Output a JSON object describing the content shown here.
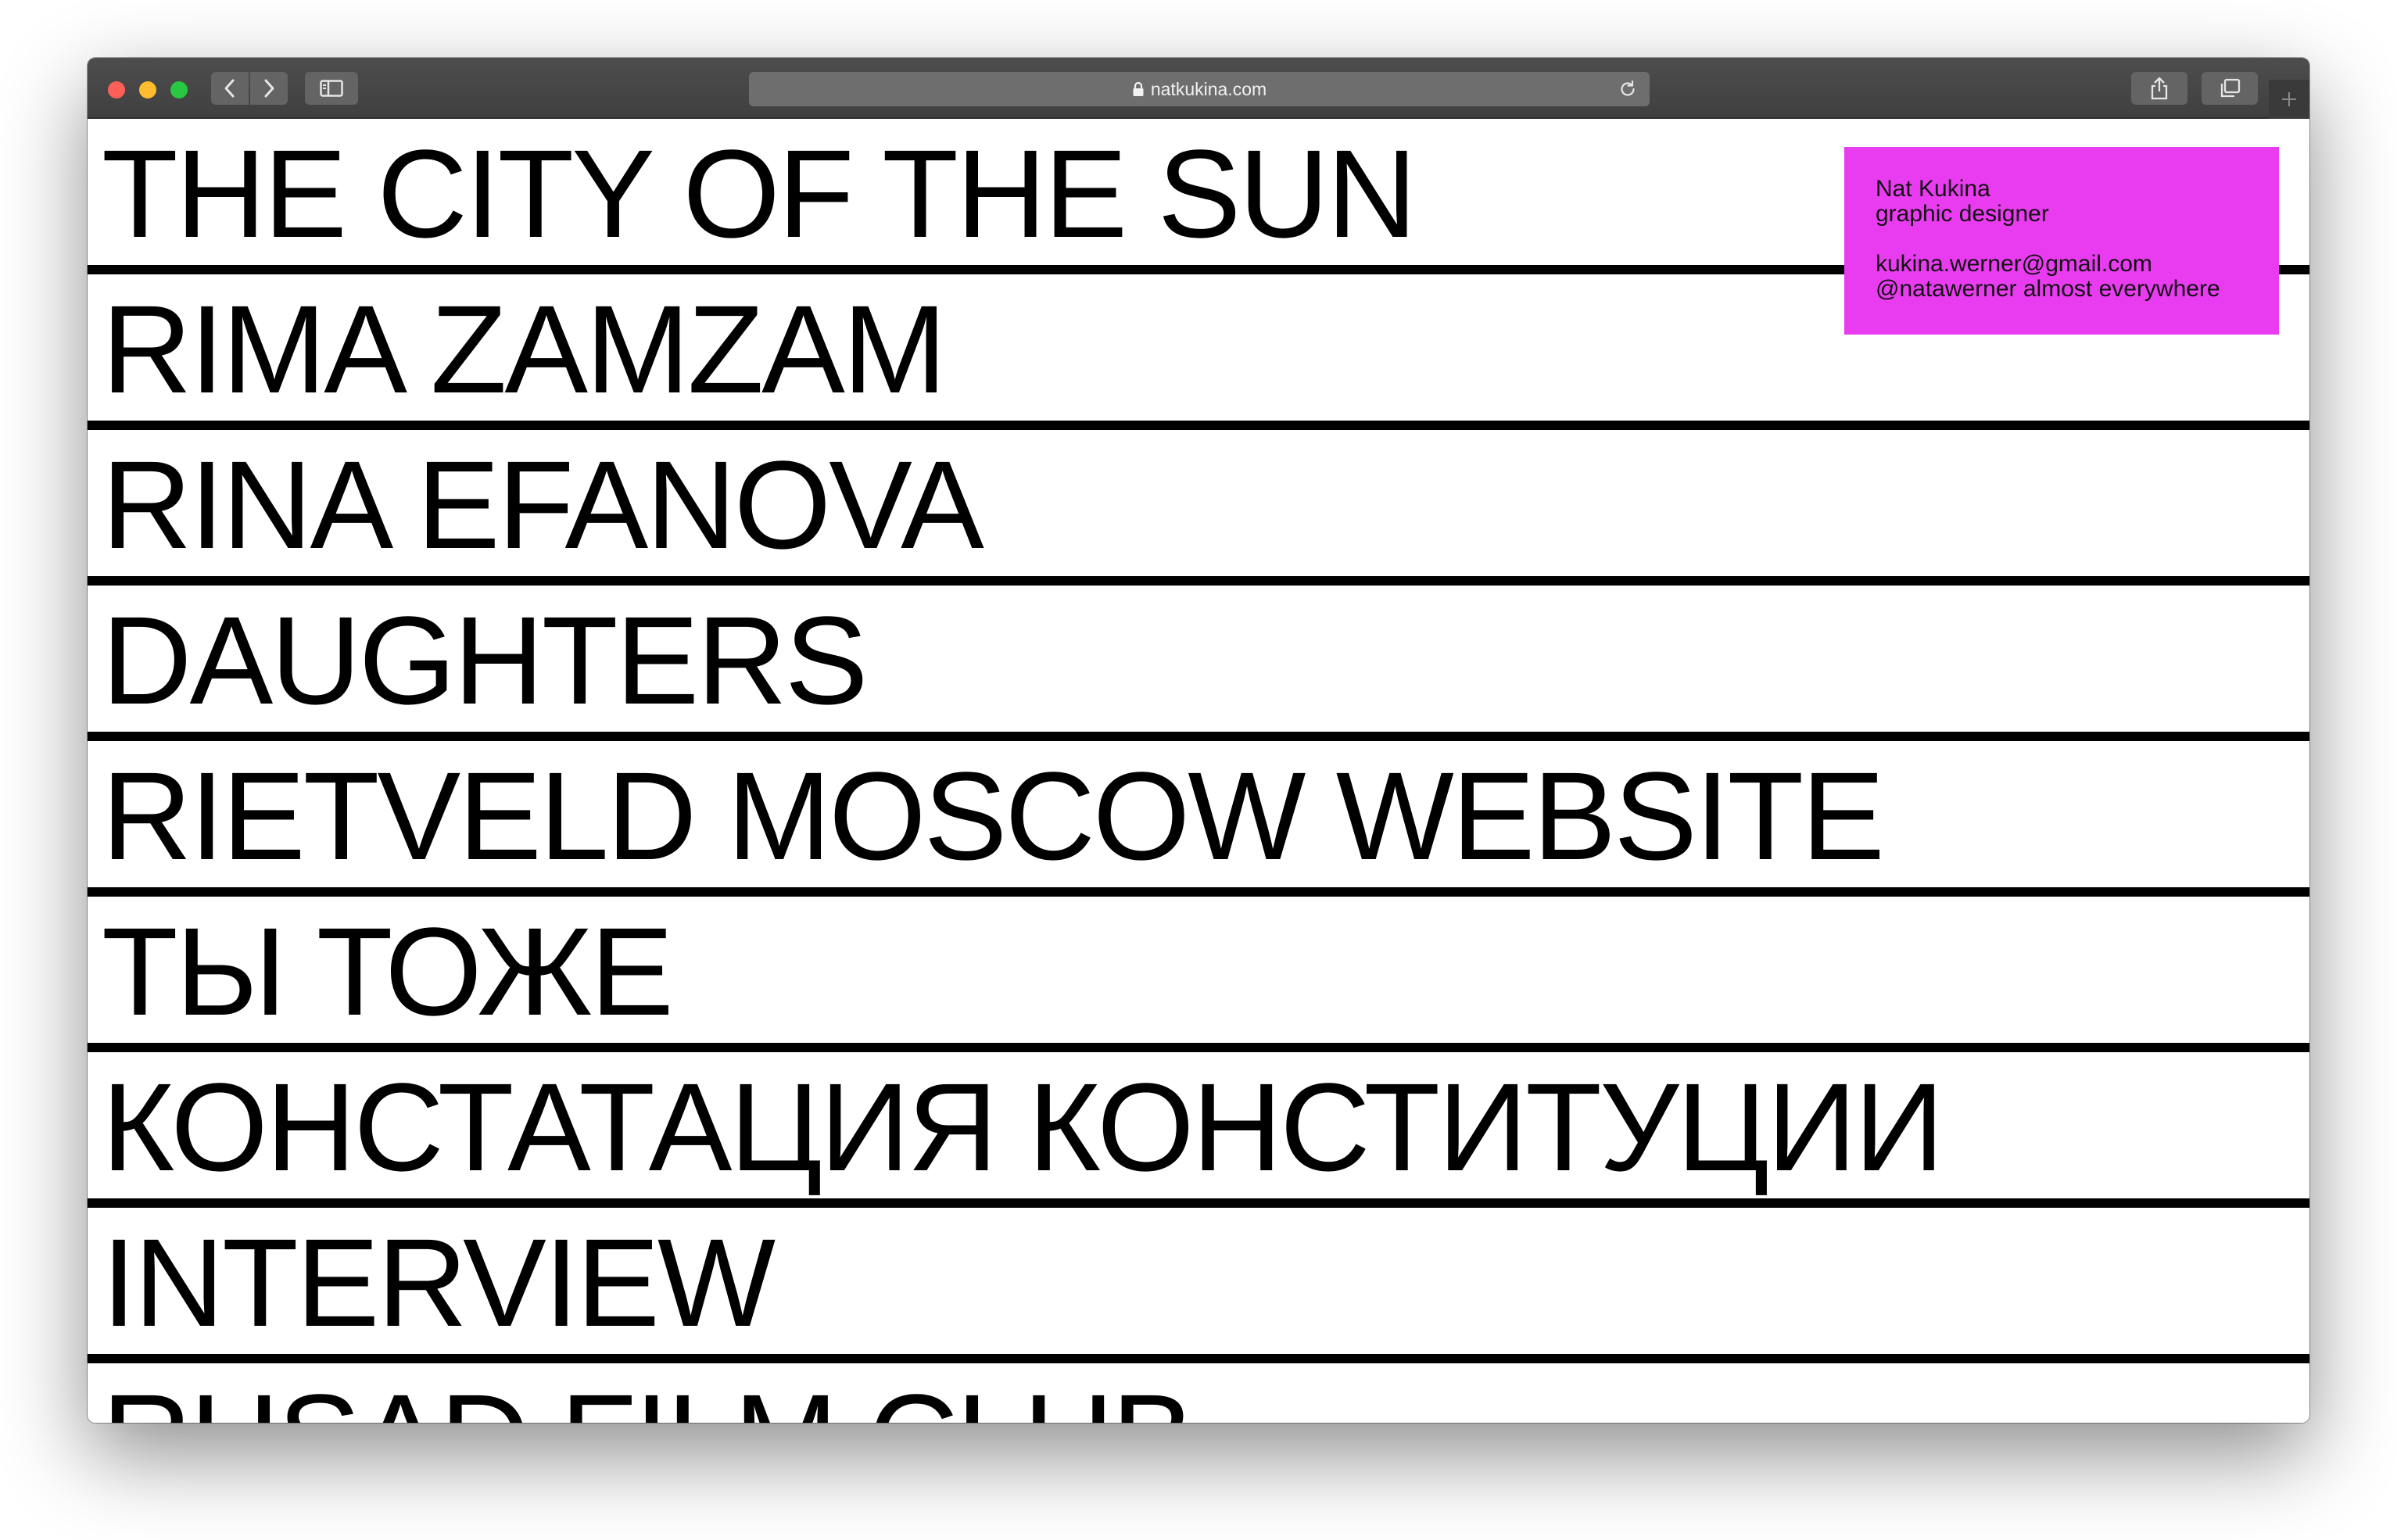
{
  "browser": {
    "url": "natkukina.com",
    "icons": {
      "back": "chevron-left-icon",
      "forward": "chevron-right-icon",
      "sidebar": "sidebar-icon",
      "lock": "lock-icon",
      "reload": "reload-icon",
      "share": "share-icon",
      "tabs": "tabs-icon",
      "new_tab": "plus-icon"
    }
  },
  "projects": [
    {
      "title": "THE CITY OF THE SUN"
    },
    {
      "title": "RIMA ZAMZAM"
    },
    {
      "title": "RINA EFANOVA"
    },
    {
      "title": "DAUGHTERS"
    },
    {
      "title": "RIETVELD MOSCOW WEBSITE"
    },
    {
      "title": "ТЫ ТОЖЕ"
    },
    {
      "title": "КОНСТАТАЦИЯ КОНСТИТУЦИИ"
    },
    {
      "title": "INTERVIEW"
    },
    {
      "title": "RHSAD FILM CLUB"
    }
  ],
  "contact_card": {
    "name": "Nat Kukina",
    "role": "graphic designer",
    "email": "kukina.werner@gmail.com",
    "handle": "@natawerner almost everywhere",
    "background_color": "#e93cf0"
  }
}
